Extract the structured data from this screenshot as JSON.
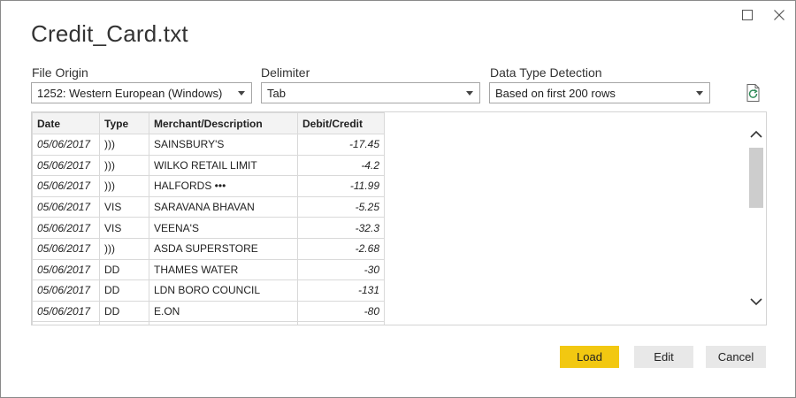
{
  "window": {
    "title": "Credit_Card.txt",
    "maximize_icon": "maximize-icon",
    "close_icon": "close-icon"
  },
  "options": {
    "file_origin": {
      "label": "File Origin",
      "value": "1252: Western European (Windows)"
    },
    "delimiter": {
      "label": "Delimiter",
      "value": "Tab"
    },
    "data_type_detection": {
      "label": "Data Type Detection",
      "value": "Based on first 200 rows"
    },
    "refresh_icon": "refresh-file-icon"
  },
  "preview": {
    "columns": [
      "Date",
      "Type",
      "Merchant/Description",
      "Debit/Credit"
    ],
    "rows": [
      {
        "date": "05/06/2017",
        "type": ")))",
        "merchant": "SAINSBURY'S",
        "amount": "-17.45"
      },
      {
        "date": "05/06/2017",
        "type": ")))",
        "merchant": "WILKO RETAIL LIMIT",
        "amount": "-4.2"
      },
      {
        "date": "05/06/2017",
        "type": ")))",
        "merchant": "HALFORDS •••",
        "amount": "-11.99"
      },
      {
        "date": "05/06/2017",
        "type": "VIS",
        "merchant": "SARAVANA BHAVAN",
        "amount": "-5.25"
      },
      {
        "date": "05/06/2017",
        "type": "VIS",
        "merchant": "VEENA'S",
        "amount": "-32.3"
      },
      {
        "date": "05/06/2017",
        "type": ")))",
        "merchant": "ASDA SUPERSTORE",
        "amount": "-2.68"
      },
      {
        "date": "05/06/2017",
        "type": "DD",
        "merchant": "THAMES WATER",
        "amount": "-30"
      },
      {
        "date": "05/06/2017",
        "type": "DD",
        "merchant": "LDN BORO COUNCIL",
        "amount": "-131"
      },
      {
        "date": "05/06/2017",
        "type": "DD",
        "merchant": "E.ON",
        "amount": "-80"
      },
      {
        "date": "",
        "type": "",
        "merchant": "",
        "amount": ""
      }
    ]
  },
  "buttons": {
    "load": "Load",
    "edit": "Edit",
    "cancel": "Cancel"
  },
  "colors": {
    "load_accent": "#f2c811",
    "secondary_button": "#e8e8e8"
  }
}
